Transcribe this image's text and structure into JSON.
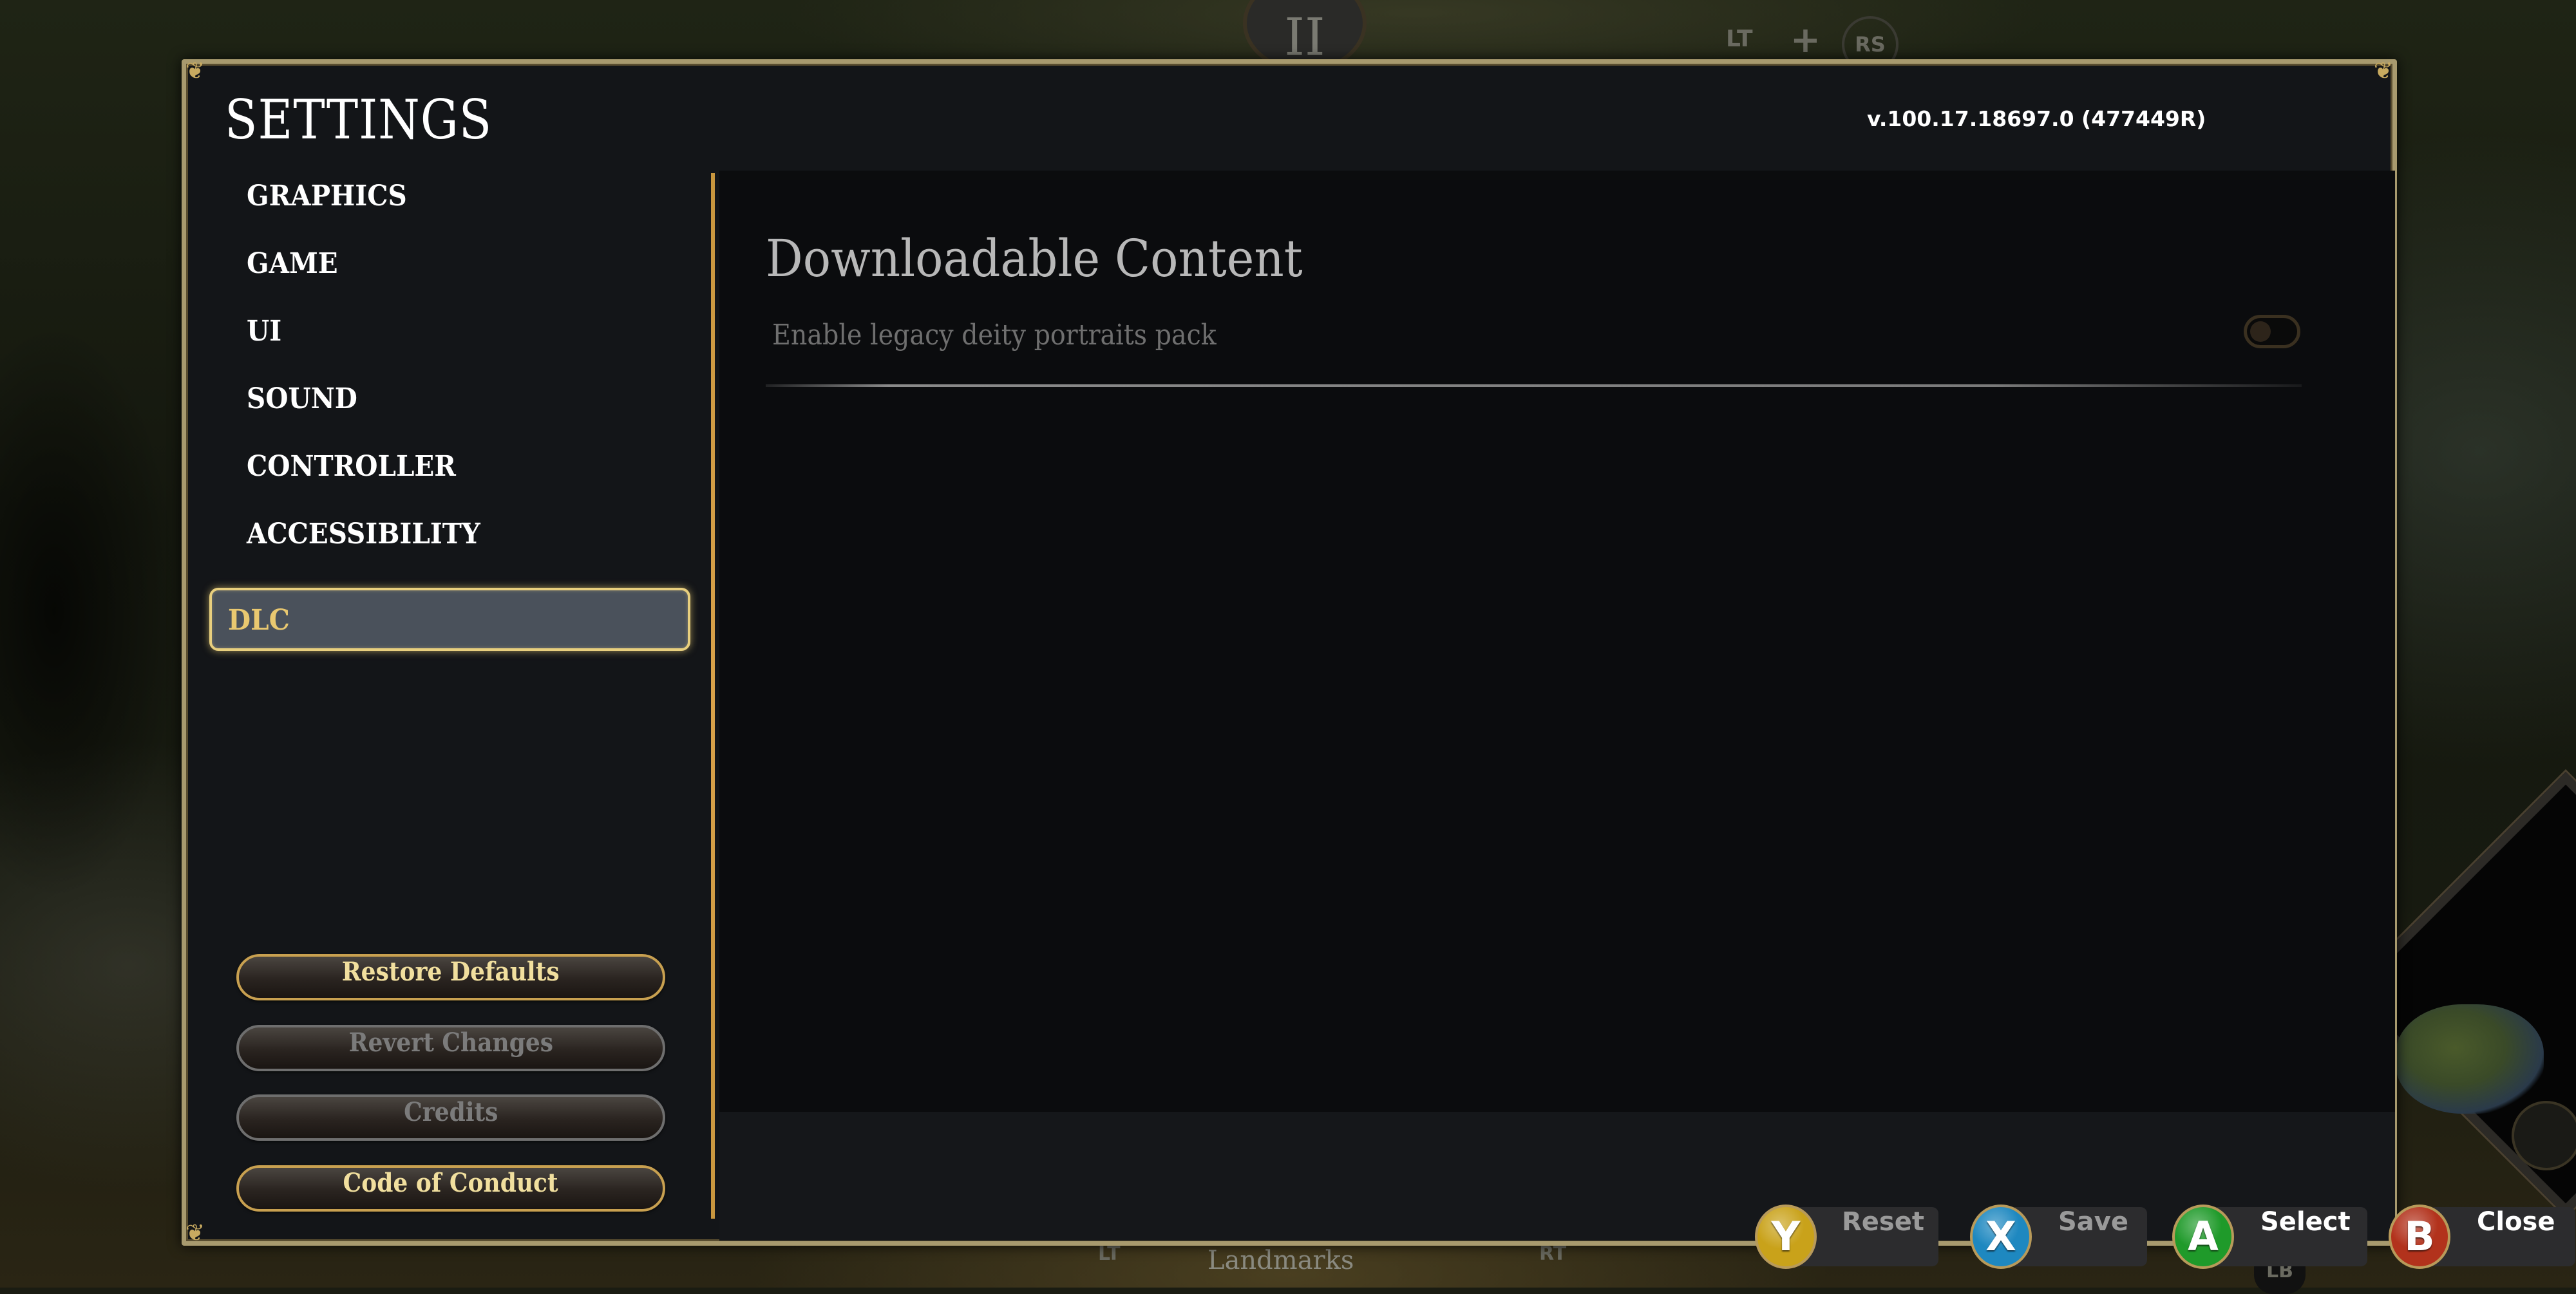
{
  "window": {
    "title": "SETTINGS",
    "version": "v.100.17.18697.0 (477449R)"
  },
  "sidebar": {
    "items": [
      {
        "label": "GRAPHICS",
        "selected": false
      },
      {
        "label": "GAME",
        "selected": false
      },
      {
        "label": "UI",
        "selected": false
      },
      {
        "label": "SOUND",
        "selected": false
      },
      {
        "label": "CONTROLLER",
        "selected": false
      },
      {
        "label": "ACCESSIBILITY",
        "selected": false
      },
      {
        "label": "DLC",
        "selected": true
      }
    ],
    "buttons": [
      {
        "label": "Restore Defaults",
        "enabled": true
      },
      {
        "label": "Revert Changes",
        "enabled": false
      },
      {
        "label": "Credits",
        "enabled": false
      },
      {
        "label": "Code of Conduct",
        "enabled": true
      }
    ]
  },
  "content": {
    "title": "Downloadable Content",
    "settings": [
      {
        "label": "Enable legacy deity portraits pack",
        "type": "toggle",
        "value": false
      }
    ]
  },
  "footer": {
    "hints": [
      {
        "button": "Y",
        "label": "Reset",
        "color": "#c9a21a",
        "label_color": "#9a9a9a"
      },
      {
        "button": "X",
        "label": "Save",
        "color": "#1e88c0",
        "label_color": "#9a9a9a"
      },
      {
        "button": "A",
        "label": "Select",
        "color": "#1f9a2a",
        "label_color": "#ffffff"
      },
      {
        "button": "B",
        "label": "Close",
        "color": "#b2321c",
        "label_color": "#ffffff"
      }
    ]
  },
  "background_hud": {
    "top_medal": "II",
    "top_lt": "LT",
    "top_plus": "+",
    "top_rs": "RS",
    "bottom_lt": "LT",
    "bottom_label": "Landmarks",
    "bottom_rt": "RT",
    "bottom_lb": "LB"
  },
  "colors": {
    "accent_gold": "#e8cf7e",
    "selected_bg": "#4a515b",
    "frame": "#a89a6e"
  }
}
